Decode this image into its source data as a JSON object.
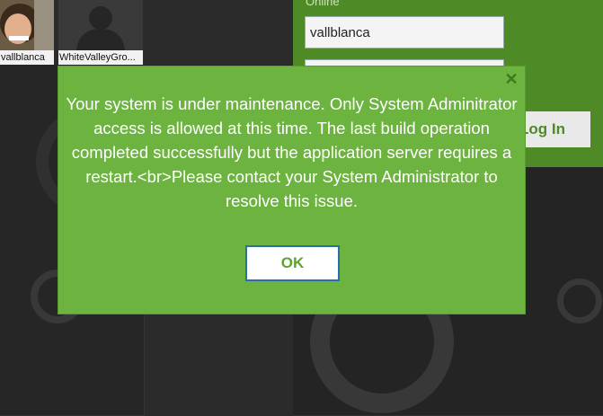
{
  "users": [
    {
      "name": "vallblanca"
    },
    {
      "name": "WhiteValleyGro..."
    }
  ],
  "login": {
    "section_label": "Online",
    "username_value": "vallblanca",
    "login_label": "Log In"
  },
  "dialog": {
    "close_icon": "✕",
    "message": "Your system is under maintenance. Only System Adminitrator access is allowed at this time. The last build operation completed successfully but the application server requires a restart.<br>Please contact your System Administrator to resolve this issue.",
    "ok_label": "OK"
  },
  "colors": {
    "dialog_bg": "#6db33f",
    "panel_bg": "#4e8a25",
    "ok_border": "#2a6eb0"
  }
}
